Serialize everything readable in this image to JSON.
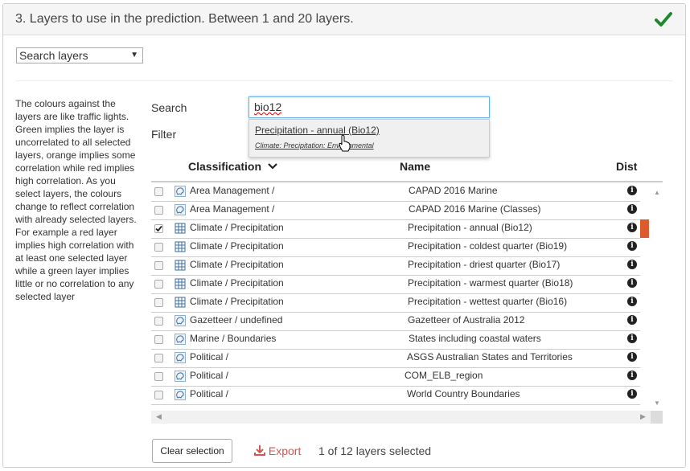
{
  "panel": {
    "title": "3. Layers to use in the prediction. Between 1 and 20 layers."
  },
  "mode_select": {
    "value": "Search layers"
  },
  "help_text": "The colours against the layers are like traffic lights. Green implies the layer is uncorrelated to all selected layers, orange implies some correlation while red implies high correlation. As you select layers, the colours change to reflect correlation with already selected layers. For example a red layer implies high correlation with at least one selected layer while a green layer implies little or no correlation to any selected layer",
  "search": {
    "label": "Search",
    "value": "bio12"
  },
  "filter": {
    "label": "Filter"
  },
  "autocomplete": {
    "title": "Precipitation - annual (Bio12)",
    "subtitle": "Climate: Precipitation: Environmental"
  },
  "table": {
    "headers": {
      "classification": "Classification",
      "name": "Name",
      "dist": "Dist"
    },
    "rows": [
      {
        "classification": "Area Management /",
        "name": "CAPAD 2016 Marine",
        "icon": "contextual-map-icon",
        "checked": false
      },
      {
        "classification": "Area Management /",
        "name": "CAPAD 2016 Marine (Classes)",
        "icon": "contextual-map-icon",
        "checked": false
      },
      {
        "classification": "Climate / Precipitation",
        "name": "Precipitation - annual (Bio12)",
        "icon": "grid-layer-icon",
        "checked": true,
        "correlation": "#dd5a2a"
      },
      {
        "classification": "Climate / Precipitation",
        "name": "Precipitation - coldest quarter (Bio19)",
        "icon": "grid-layer-icon",
        "checked": false
      },
      {
        "classification": "Climate / Precipitation",
        "name": "Precipitation - driest quarter (Bio17)",
        "icon": "grid-layer-icon",
        "checked": false
      },
      {
        "classification": "Climate / Precipitation",
        "name": "Precipitation - warmest quarter (Bio18)",
        "icon": "grid-layer-icon",
        "checked": false
      },
      {
        "classification": "Climate / Precipitation",
        "name": "Precipitation - wettest quarter (Bio16)",
        "icon": "grid-layer-icon",
        "checked": false
      },
      {
        "classification": "Gazetteer / undefined",
        "name": "Gazetteer of Australia 2012",
        "icon": "contextual-map-icon",
        "checked": false
      },
      {
        "classification": "Marine / Boundaries",
        "name": "States including coastal waters",
        "icon": "contextual-map-icon",
        "checked": false
      },
      {
        "classification": "Political /",
        "name": "ASGS Australian States and Territories",
        "icon": "contextual-map-icon",
        "checked": false
      },
      {
        "classification": "Political /",
        "name": "COM_ELB_region",
        "icon": "contextual-map-icon",
        "checked": false
      },
      {
        "classification": "Political /",
        "name": "World Country Boundaries",
        "icon": "contextual-map-icon",
        "checked": false
      }
    ]
  },
  "footer": {
    "clear_label": "Clear selection",
    "export_label": "Export",
    "status": "1 of 12 layers selected"
  },
  "colors": {
    "accent_green": "#1e8a2e",
    "export_red": "#d9534f",
    "focus_blue": "#66afe9"
  }
}
